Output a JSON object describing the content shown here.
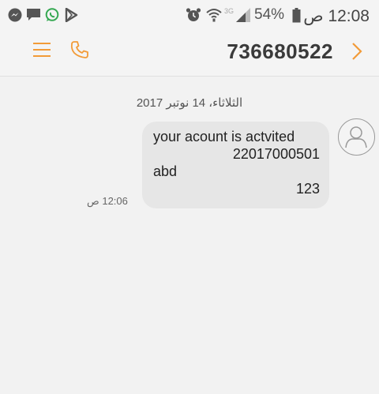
{
  "status_bar": {
    "time": "12:08 ص",
    "battery_percent": "54%",
    "network_label": "3G",
    "left_icons": [
      "messenger-icon",
      "chat-icon",
      "whatsapp-icon",
      "play-store-icon"
    ],
    "right_icons": [
      "alarm-icon",
      "wifi-icon",
      "signal-icon",
      "battery-icon"
    ]
  },
  "header": {
    "contact_number": "736680522"
  },
  "conversation": {
    "date": "الثلاثاء، 14 نوتبر 2017",
    "message": {
      "line1": "your acount is actvited",
      "line2": "22017000501",
      "line3": "abd",
      "line4": "123",
      "time": "12:06 ص"
    }
  },
  "colors": {
    "accent": "#f29b38",
    "bubble": "#e6e6e6",
    "background": "#f2f2f2"
  }
}
